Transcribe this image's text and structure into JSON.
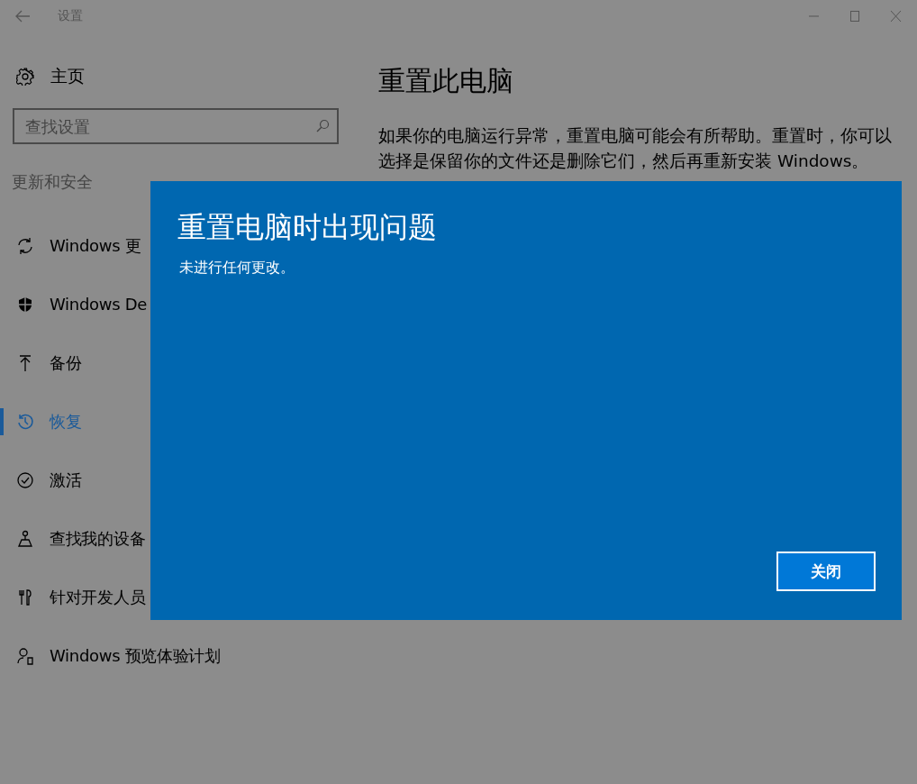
{
  "window": {
    "title": "设置"
  },
  "sidebar": {
    "home": "主页",
    "search": {
      "placeholder": "查找设置"
    },
    "section": "更新和安全",
    "items": [
      {
        "label": "Windows 更",
        "selected": false
      },
      {
        "label": "Windows De",
        "selected": false
      },
      {
        "label": "备份",
        "selected": false
      },
      {
        "label": "恢复",
        "selected": true
      },
      {
        "label": "激活",
        "selected": false
      },
      {
        "label": "查找我的设备",
        "selected": false
      },
      {
        "label": "针对开发人员",
        "selected": false
      },
      {
        "label": "Windows 预览体验计划",
        "selected": false
      }
    ]
  },
  "content": {
    "title": "重置此电脑",
    "description": "如果你的电脑运行异常，重置电脑可能会有所帮助。重置时，你可以选择是保留你的文件还是删除它们，然后再重新安装 Windows。"
  },
  "dialog": {
    "title": "重置电脑时出现问题",
    "message": "未进行任何更改。",
    "button": "关闭"
  }
}
